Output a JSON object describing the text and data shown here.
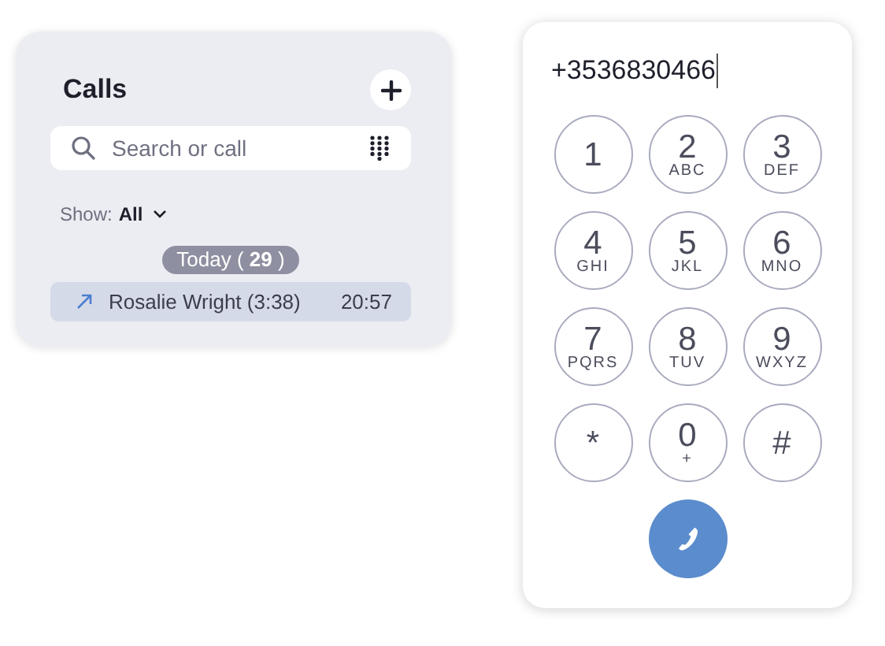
{
  "calls_panel": {
    "title": "Calls",
    "search": {
      "placeholder": "Search or call"
    },
    "filter": {
      "label": "Show:",
      "value": "All"
    },
    "group": {
      "label": "Today ( **29** )"
    },
    "rows": [
      {
        "name": "Rosalie Wright (3:38)",
        "time": "20:57",
        "kind": "outgoing",
        "selected": true
      }
    ]
  },
  "dialer": {
    "number": "+3536830466",
    "keys": [
      {
        "digit": "1"
      },
      {
        "digit": "2",
        "letters": "ABC"
      },
      {
        "digit": "3",
        "letters": "DEF"
      },
      {
        "digit": "4",
        "letters": "GHI"
      },
      {
        "digit": "5",
        "letters": "JKL"
      },
      {
        "digit": "6",
        "letters": "MNO"
      },
      {
        "digit": "7",
        "letters": "PQRS"
      },
      {
        "digit": "8",
        "letters": "TUV"
      },
      {
        "digit": "9",
        "letters": "WXYZ"
      },
      {
        "digit": "*"
      },
      {
        "digit": "0",
        "letters": "+"
      },
      {
        "digit": "#"
      }
    ]
  }
}
